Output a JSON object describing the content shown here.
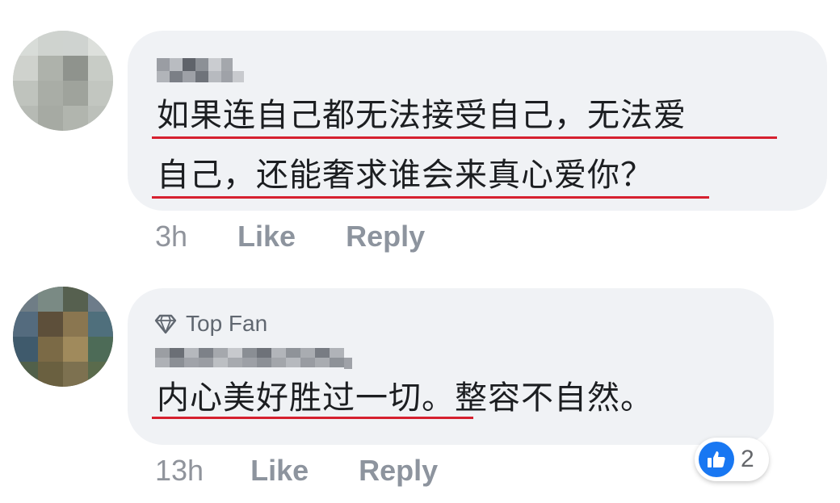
{
  "comments": [
    {
      "avatar": "blurred-avatar",
      "author": "",
      "line1": "如果连自己都无法接受自己，无法爱",
      "line2": "自己，还能奢求谁会来真心爱你？",
      "time": "3h",
      "like_label": "Like",
      "reply_label": "Reply"
    },
    {
      "avatar": "blurred-avatar",
      "badge_icon": "diamond-icon",
      "badge_label": "Top Fan",
      "author": "",
      "text_underlined": "内心美好胜过一切",
      "text_rest": "。整容不自然。",
      "time": "13h",
      "like_label": "Like",
      "reply_label": "Reply",
      "reaction_icon": "thumbs-up-icon",
      "reaction_count": "2"
    }
  ],
  "colors": {
    "bubble": "#f0f2f5",
    "underline": "#d6202f",
    "action_text": "#8d949e",
    "like_blue": "#1877f2"
  }
}
